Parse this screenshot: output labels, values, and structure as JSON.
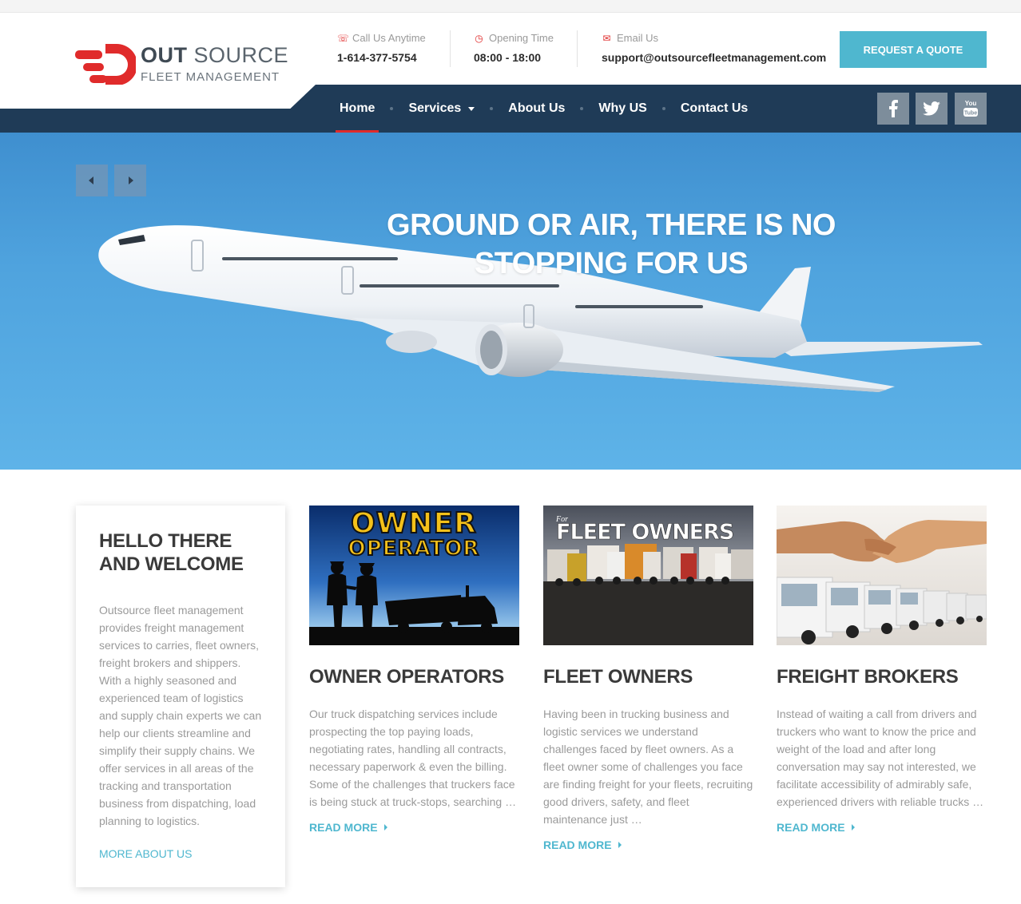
{
  "brand": {
    "name_bold": "OUT",
    "name_light": "SOURCE",
    "tagline": "FLEET MANAGEMENT"
  },
  "contact": {
    "call": {
      "label": "Call Us Anytime",
      "value": "1-614-377-5754",
      "icon": "headset-icon"
    },
    "hours": {
      "label": "Opening Time",
      "value": "08:00 - 18:00",
      "icon": "clock-icon"
    },
    "email": {
      "label": "Email Us",
      "value": "support@outsourcefleetmanagement.com",
      "icon": "envelope-icon"
    }
  },
  "cta": {
    "label": "REQUEST A QUOTE"
  },
  "nav": {
    "items": [
      {
        "label": "Home",
        "active": true
      },
      {
        "label": "Services",
        "dropdown": true
      },
      {
        "label": "About Us"
      },
      {
        "label": "Why US"
      },
      {
        "label": "Contact Us"
      }
    ]
  },
  "social": [
    "facebook-icon",
    "twitter-icon",
    "youtube-icon"
  ],
  "social_labels": {
    "youtube_line1": "You",
    "youtube_line2": "Tube"
  },
  "hero": {
    "title": "GROUND OR AIR, THERE IS NO STOPPING FOR US"
  },
  "welcome": {
    "title": "HELLO THERE AND WELCOME",
    "body": "Outsource fleet management provides freight management services to carries, fleet owners, freight brokers and shippers. With a highly seasoned and experienced team of logistics and supply chain experts we can help our clients streamline and simplify their supply chains. We offer services in all areas of the tracking and transportation business from dispatching, load planning to logistics.",
    "link": "MORE ABOUT US"
  },
  "cards": [
    {
      "title": "OWNER OPERATORS",
      "image_text_1": "OWNER",
      "image_text_2": "OPERATOR",
      "body": "Our truck dispatching services include prospecting the top paying loads, negotiating rates, handling all contracts, necessary paperwork & even the billing. Some of the challenges that truckers face is being stuck at truck-stops, searching …",
      "link": "READ MORE"
    },
    {
      "title": "FLEET OWNERS",
      "image_text_small": "For",
      "image_text": "FLEET OWNERS",
      "body": "Having been in trucking business and logistic services we understand challenges faced by fleet owners. As a fleet owner some of challenges you face are finding freight for your fleets, recruiting good drivers, safety, and fleet maintenance just …",
      "link": "READ MORE"
    },
    {
      "title": "FREIGHT BROKERS",
      "body": "Instead of waiting a call from drivers and truckers who want to know the price and weight of the load and after long conversation may say not interested, we facilitate accessibility of admirably safe, experienced drivers with reliable trucks …",
      "link": "READ MORE"
    }
  ],
  "colors": {
    "accent": "#4fb7cf",
    "brand_red": "#e02b2b",
    "nav_bg": "#1f3b57"
  }
}
